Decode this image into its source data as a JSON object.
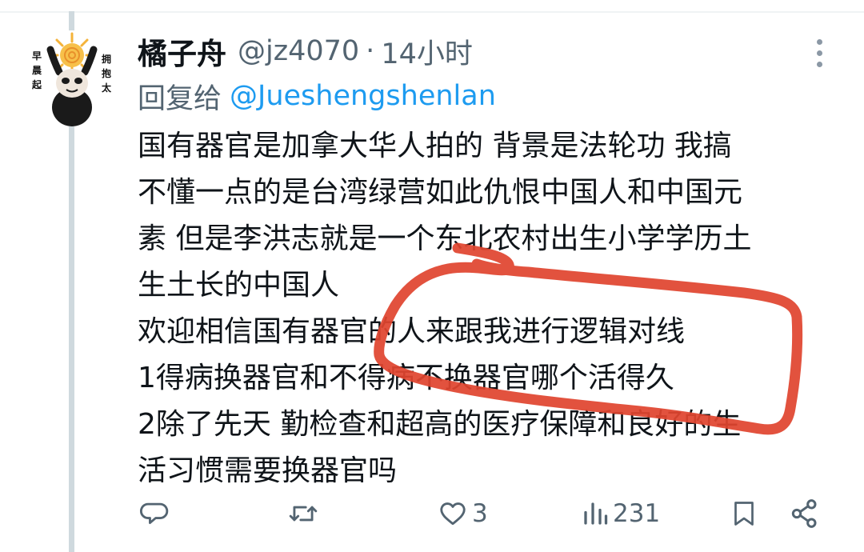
{
  "tweet": {
    "display_name": "橘子舟",
    "handle": "@jz4070",
    "separator": "·",
    "timestamp": "14小时",
    "reply_prefix": "回复给",
    "reply_to": "@Jueshengshenlan",
    "body_lines": [
      "国有器官是加拿大华人拍的 背景是法轮功 我搞",
      "不懂一点的是台湾绿营如此仇恨中国人和中国元",
      "素 但是李洪志就是一个东北农村出生小学学历土",
      "生土长的中国人",
      "欢迎相信国有器官的人来跟我进行逻辑对线",
      "1得病换器官和不得病不换器官哪个活得久",
      "2除了先天 勤检查和超高的医疗保障和良好的生",
      "活习惯需要换器官吗"
    ]
  },
  "avatar": {
    "text_left": [
      "早",
      "晨",
      "起"
    ],
    "text_right": [
      "拥",
      "抱",
      "太"
    ]
  },
  "actions": {
    "reply_icon": "speech-bubble-icon",
    "retweet_icon": "retweet-arrows-icon",
    "like_icon": "heart-outline-icon",
    "like_count": "3",
    "views_icon": "bar-chart-icon",
    "views_count": "231",
    "bookmark_icon": "bookmark-icon",
    "share_icon": "share-nodes-icon"
  },
  "colors": {
    "text": "#0f1419",
    "secondary": "#536471",
    "link": "#1d9bf0",
    "annotation": "#e0452f",
    "thread_line": "#cfd9de"
  }
}
